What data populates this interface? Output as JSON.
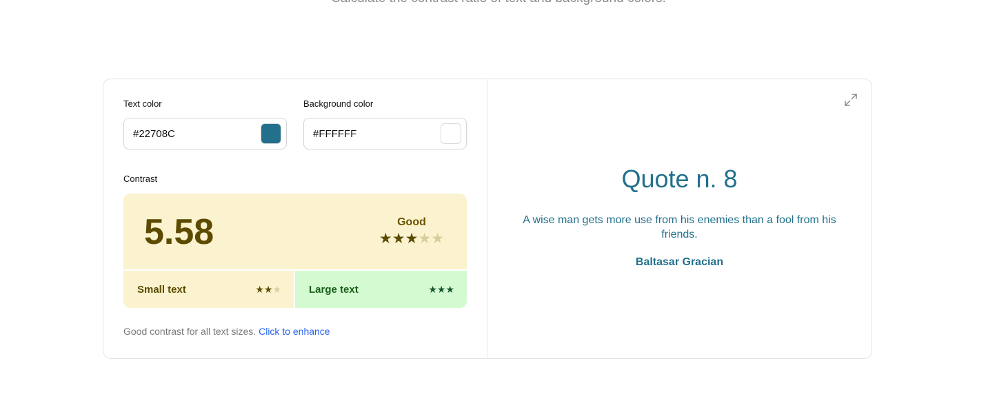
{
  "header": {
    "subtitle": "Calculate the contrast ratio of text and background colors."
  },
  "inputs": {
    "text_color": {
      "label": "Text color",
      "value": "#22708C",
      "swatch": "#22708C"
    },
    "background_color": {
      "label": "Background color",
      "value": "#FFFFFF",
      "swatch": "#FFFFFF"
    }
  },
  "contrast": {
    "label": "Contrast",
    "ratio": "5.58",
    "rating": "Good",
    "stars": {
      "filled": 3,
      "total": 5
    },
    "small_text": {
      "label": "Small text",
      "stars_filled": 2,
      "stars_total": 3
    },
    "large_text": {
      "label": "Large text",
      "stars_filled": 3,
      "stars_total": 3
    },
    "colors": {
      "box_warning": "#fbf3cf",
      "box_success": "#d3fad1",
      "text_dark": "#5c4a00"
    }
  },
  "footer": {
    "note": "Good contrast for all text sizes.",
    "link": "Click to enhance"
  },
  "preview": {
    "expand_icon": "expand-icon",
    "title": "Quote n. 8",
    "quote": "A wise man gets more use from his enemies than a fool from his friends.",
    "author": "Baltasar Gracian",
    "text_color": "#22708C",
    "background_color": "#FFFFFF"
  }
}
